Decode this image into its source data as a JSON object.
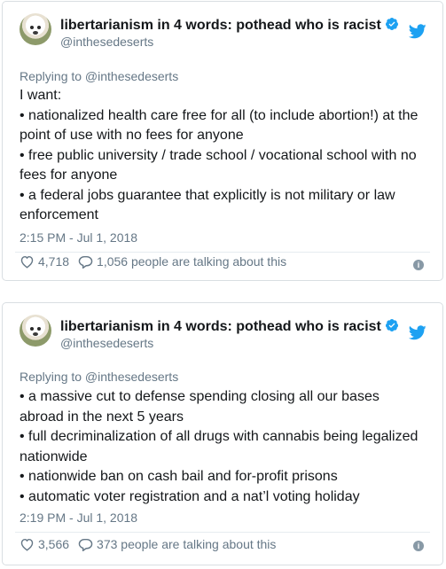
{
  "tweets": [
    {
      "author_name": "libertarianism in 4 words: pothead who is racist",
      "handle": "@inthesedeserts",
      "replying_to": "Replying to @inthesedeserts",
      "lines": [
        "I want:",
        "• nationalized health care free for all (to include abortion!) at the point of use with no fees for anyone",
        "• free public university / trade school / vocational school with no fees for anyone",
        "• a federal jobs guarantee that explicitly is not military or law enforcement"
      ],
      "timestamp": "2:15 PM - Jul 1, 2018",
      "likes": "4,718",
      "talking": "1,056 people are talking about this"
    },
    {
      "author_name": "libertarianism in 4 words: pothead who is racist",
      "handle": "@inthesedeserts",
      "replying_to": "Replying to @inthesedeserts",
      "lines": [
        "• a massive cut to defense spending closing all our bases abroad in the next 5 years",
        "• full decriminalization of all drugs with cannabis being legalized nationwide",
        "• nationwide ban on cash bail and for-profit prisons",
        "• automatic voter registration and a nat’l voting holiday"
      ],
      "timestamp": "2:19 PM - Jul 1, 2018",
      "likes": "3,566",
      "talking": "373 people are talking about this"
    }
  ],
  "colors": {
    "text": "#14171a",
    "muted": "#657786",
    "twitter_blue": "#1da1f2",
    "border": "#d9dee2"
  },
  "icons": [
    "verified-badge-icon",
    "twitter-bird-icon",
    "heart-icon",
    "reply-bubble-icon",
    "info-icon"
  ]
}
